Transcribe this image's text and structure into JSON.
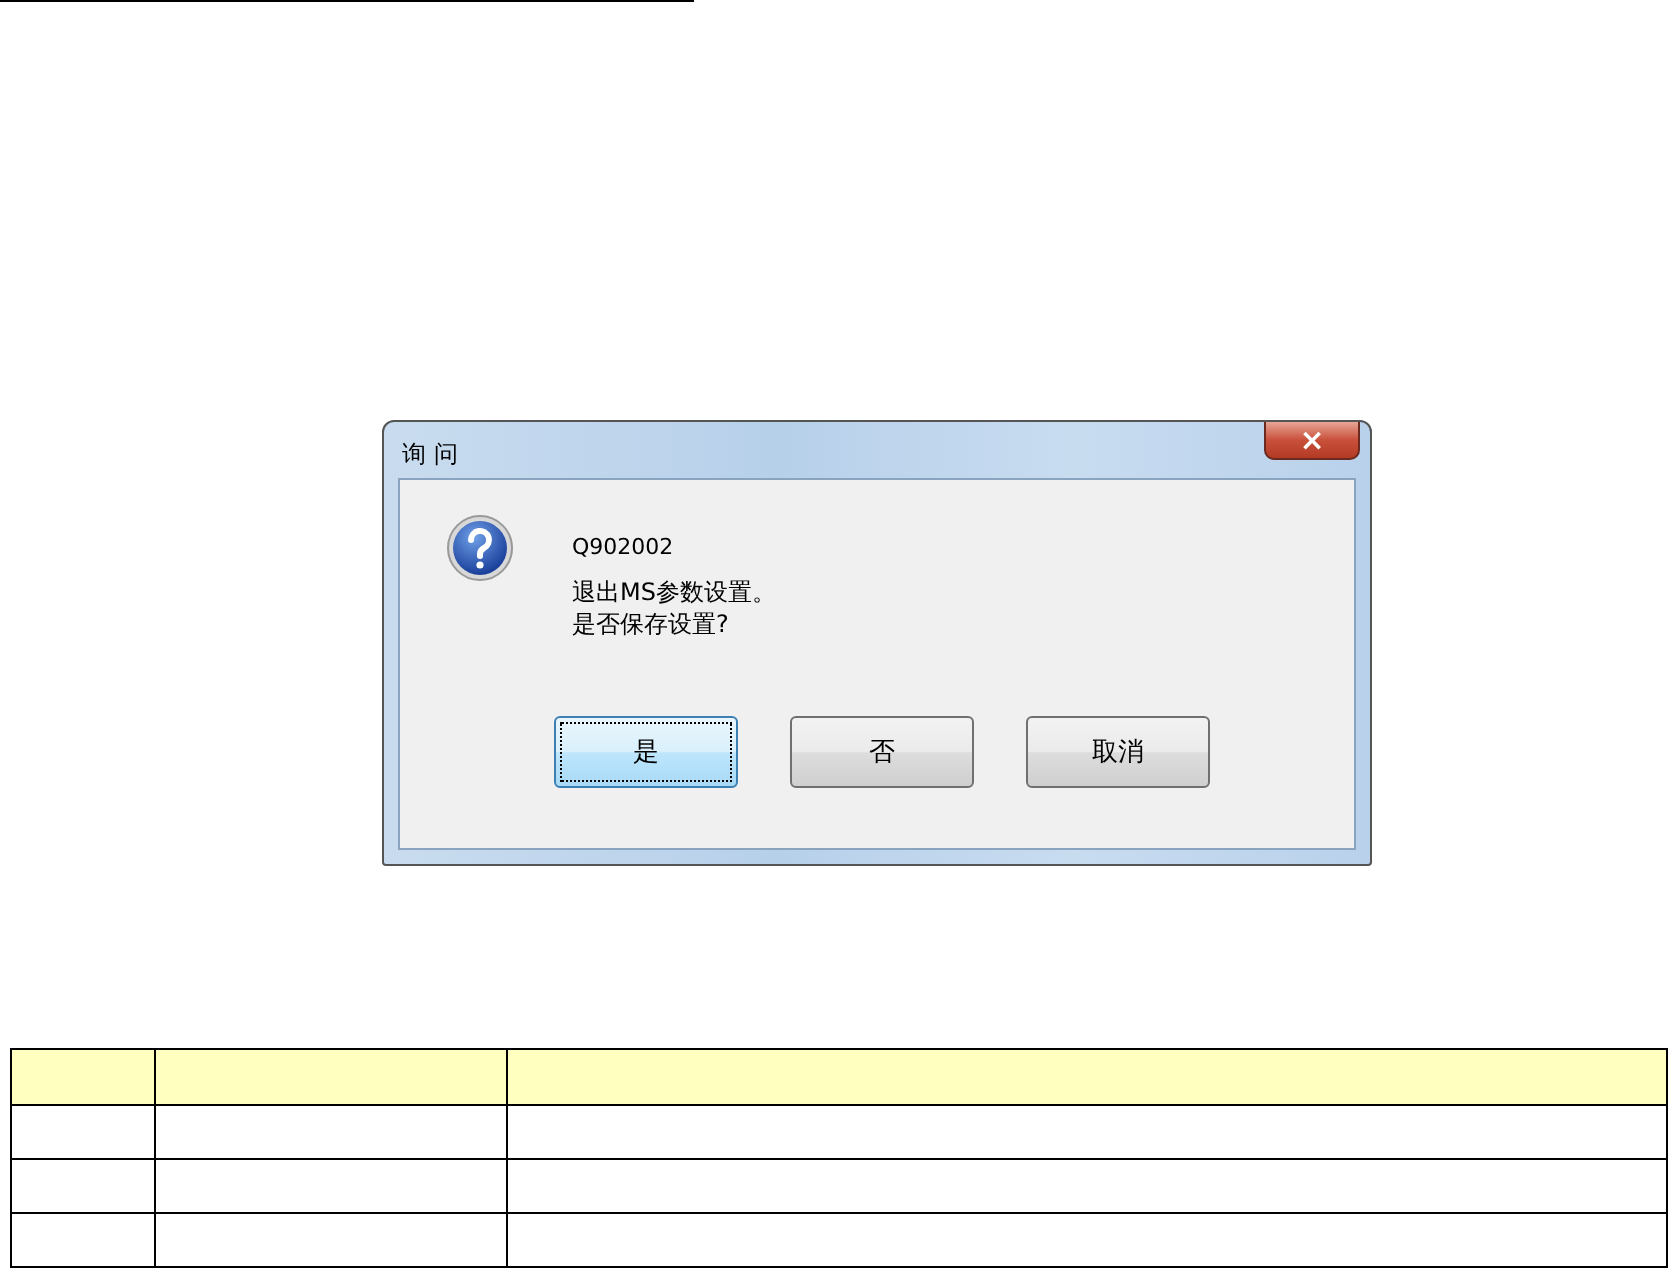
{
  "dialog": {
    "title": "询 问",
    "close_button": "×",
    "code": "Q902002",
    "message": [
      "退出MS参数设置。",
      "是否保存设置?"
    ],
    "buttons": [
      {
        "label": "是",
        "focused": true
      },
      {
        "label": "否",
        "focused": false
      },
      {
        "label": "取消",
        "focused": false
      }
    ]
  }
}
